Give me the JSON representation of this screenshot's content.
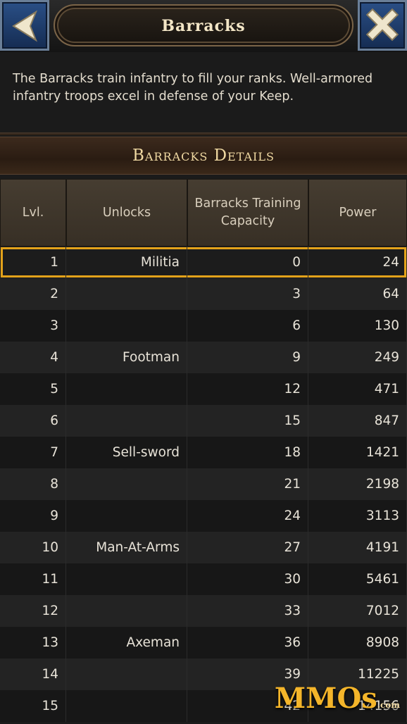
{
  "header": {
    "title": "Barracks",
    "back_icon": "back-arrow-icon",
    "close_icon": "close-x-icon",
    "colors": {
      "button_blue": "#1f3f72",
      "title_text": "#f3e6c6"
    }
  },
  "description": "The Barracks train infantry to fill your ranks. Well-armored infantry troops excel in defense of your Keep.",
  "section_title": "Barracks Details",
  "table": {
    "columns": [
      "Lvl.",
      "Unlocks",
      "Barracks Training Capacity",
      "Power"
    ],
    "rows": [
      {
        "lvl": "1",
        "unlock": "Militia",
        "capacity": "0",
        "power": "24"
      },
      {
        "lvl": "2",
        "unlock": "",
        "capacity": "3",
        "power": "64"
      },
      {
        "lvl": "3",
        "unlock": "",
        "capacity": "6",
        "power": "130"
      },
      {
        "lvl": "4",
        "unlock": "Footman",
        "capacity": "9",
        "power": "249"
      },
      {
        "lvl": "5",
        "unlock": "",
        "capacity": "12",
        "power": "471"
      },
      {
        "lvl": "6",
        "unlock": "",
        "capacity": "15",
        "power": "847"
      },
      {
        "lvl": "7",
        "unlock": "Sell-sword",
        "capacity": "18",
        "power": "1421"
      },
      {
        "lvl": "8",
        "unlock": "",
        "capacity": "21",
        "power": "2198"
      },
      {
        "lvl": "9",
        "unlock": "",
        "capacity": "24",
        "power": "3113"
      },
      {
        "lvl": "10",
        "unlock": "Man-At-Arms",
        "capacity": "27",
        "power": "4191"
      },
      {
        "lvl": "11",
        "unlock": "",
        "capacity": "30",
        "power": "5461"
      },
      {
        "lvl": "12",
        "unlock": "",
        "capacity": "33",
        "power": "7012"
      },
      {
        "lvl": "13",
        "unlock": "Axeman",
        "capacity": "36",
        "power": "8908"
      },
      {
        "lvl": "14",
        "unlock": "",
        "capacity": "39",
        "power": "11225"
      },
      {
        "lvl": "15",
        "unlock": "",
        "capacity": "42",
        "power": "14156"
      }
    ],
    "selected_row_color": "#e3a21a"
  },
  "watermark": {
    "text": "MMOs",
    "suffix": ".com"
  }
}
